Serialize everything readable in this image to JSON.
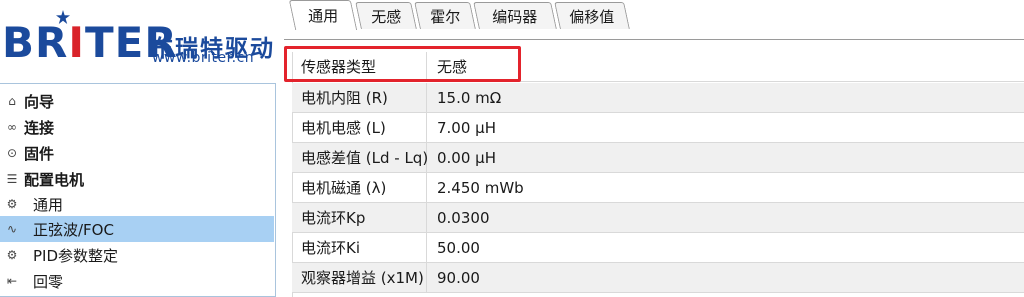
{
  "logo": {
    "brand_letters": [
      "BR",
      "I",
      "TER"
    ],
    "brand_cn": "布瑞特驱动",
    "url": "www.briter.cn",
    "colors": {
      "brand_blue": "#1b4a9c",
      "accent_red": "#d9232a"
    }
  },
  "sidebar": {
    "items": [
      {
        "icon": "home-icon",
        "glyph": "⌂",
        "label": "向导",
        "style": "bold"
      },
      {
        "icon": "link-icon",
        "glyph": "∞",
        "label": "连接",
        "style": "bold"
      },
      {
        "icon": "firmware-icon",
        "glyph": "⊙",
        "label": "固件",
        "style": "bold"
      },
      {
        "icon": "settings-sliders-icon",
        "glyph": "☰",
        "label": "配置电机",
        "style": "bold"
      },
      {
        "icon": "gear-icon",
        "glyph": "⚙",
        "label": "通用",
        "style": "normal"
      },
      {
        "icon": "sine-wave-icon",
        "glyph": "∿",
        "label": "正弦波/FOC",
        "style": "normal",
        "active": true
      },
      {
        "icon": "tuning-icon",
        "glyph": "⚙",
        "label": "PID参数整定",
        "style": "normal"
      },
      {
        "icon": "return-zero-icon",
        "glyph": "⇤",
        "label": "回零",
        "style": "normal"
      }
    ],
    "active_color": "#a8d0f3"
  },
  "tabs": [
    {
      "label": "通用",
      "active": true
    },
    {
      "label": "无感",
      "active": false
    },
    {
      "label": "霍尔",
      "active": false
    },
    {
      "label": "编码器",
      "active": false
    },
    {
      "label": "偏移值",
      "active": false
    }
  ],
  "properties": [
    {
      "key": "传感器类型",
      "value": "无感"
    },
    {
      "key": "电机内阻 (R)",
      "value": "15.0 mΩ"
    },
    {
      "key": "电机电感 (L)",
      "value": "7.00 µH"
    },
    {
      "key": "电感差值 (Ld - Lq)",
      "value": "0.00 µH"
    },
    {
      "key": "电机磁通 (λ)",
      "value": "2.450 mWb"
    },
    {
      "key": "电流环Kp",
      "value": "0.0300"
    },
    {
      "key": "电流环Ki",
      "value": "50.00"
    },
    {
      "key": "观察器增益 (x1M)",
      "value": "90.00"
    }
  ],
  "highlight_color": "#e3232c"
}
